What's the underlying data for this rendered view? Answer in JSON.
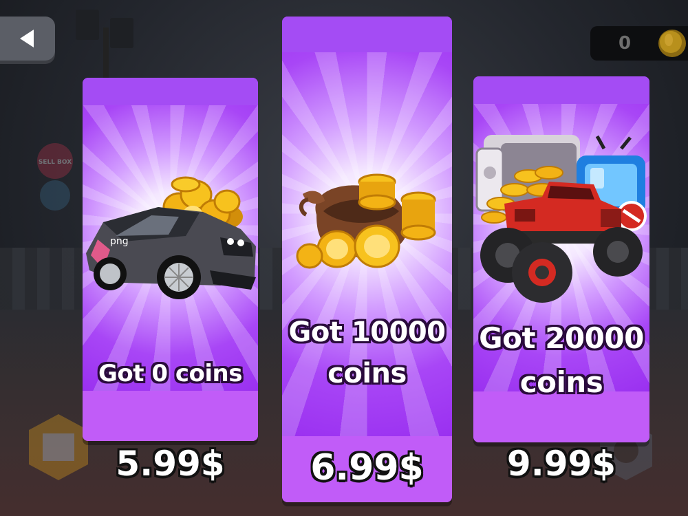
{
  "header": {
    "back_icon": "back-arrow-icon",
    "coin_count": "0",
    "coin_icon": "coin-icon"
  },
  "offers": [
    {
      "label": "Got 0 coins",
      "price": "5.99$",
      "illustration": "rally-car-with-coins",
      "car_decal": "png"
    },
    {
      "label_line1": "Got 10000",
      "label_line2": "coins",
      "price": "6.99$",
      "illustration": "coin-sack"
    },
    {
      "label_line1": "Got 20000",
      "label_line2": "coins",
      "price": "9.99$",
      "illustration": "monster-truck-safe-bundle"
    }
  ],
  "background_hud": {
    "sell_badge": "SELL BOX"
  },
  "colors": {
    "card_purple": "#9b34f0",
    "card_band": "#c15cf8",
    "coin_gold": "#f5b21a",
    "truck_red": "#d42a22"
  }
}
